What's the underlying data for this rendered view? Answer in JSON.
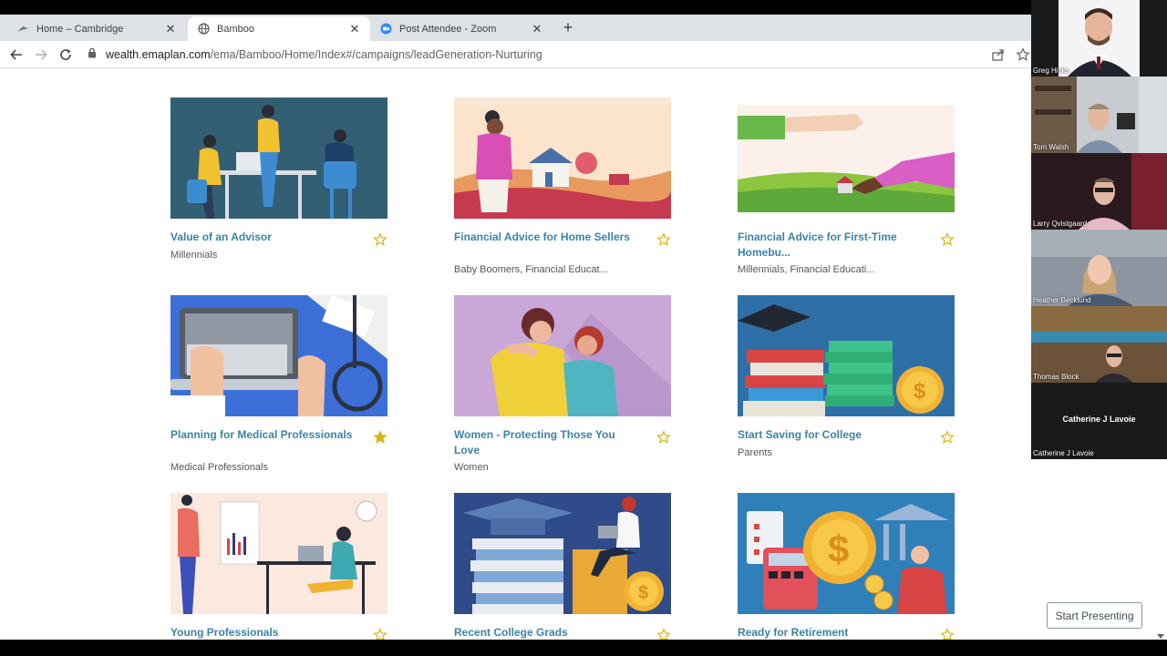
{
  "browser": {
    "tabs": [
      {
        "label": "Home – Cambridge",
        "active": false
      },
      {
        "label": "Bamboo",
        "active": true
      },
      {
        "label": "Post Attendee - Zoom",
        "active": false
      }
    ],
    "url_domain": "wealth.emaplan.com",
    "url_path": "/ema/Bamboo/Home/Index#/campaigns/leadGeneration-Nurturing"
  },
  "cards": [
    {
      "title": "Value of an Advisor",
      "tags": "Millennials",
      "favorited": false
    },
    {
      "title": "Financial Advice for Home Sellers",
      "tags": "Baby Boomers, Financial Educat...",
      "favorited": false
    },
    {
      "title": "Financial Advice for First-Time Homebu...",
      "tags": "Millennials, Financial Educati...",
      "favorited": false
    },
    {
      "title": "Planning for Medical Professionals",
      "tags": "Medical Professionals",
      "favorited": true
    },
    {
      "title": "Women - Protecting Those You Love",
      "tags": "Women",
      "favorited": false
    },
    {
      "title": "Start Saving for College",
      "tags": "Parents",
      "favorited": false
    },
    {
      "title": "Young Professionals",
      "tags": "",
      "favorited": false
    },
    {
      "title": "Recent College Grads",
      "tags": "",
      "favorited": false
    },
    {
      "title": "Ready for Retirement",
      "tags": "",
      "favorited": false
    }
  ],
  "start_presenting": "Start Presenting",
  "participants": [
    {
      "name": "Greg Hicks"
    },
    {
      "name": "Tom Walsh"
    },
    {
      "name": "Larry Qvistgaard"
    },
    {
      "name": "Heather Becklund"
    },
    {
      "name": "Thomas Block"
    },
    {
      "name": "Catherine J Lavoie"
    }
  ],
  "colors": {
    "accent": "#3a83a8",
    "star": "#d9b40e"
  }
}
